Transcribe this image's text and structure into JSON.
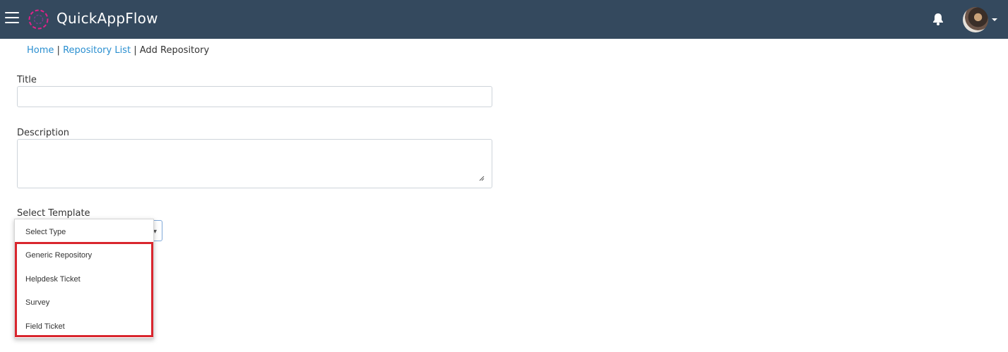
{
  "header": {
    "app_title": "QuickAppFlow",
    "menu_icon": "hamburger-menu-icon",
    "logo_icon": "app-logo-icon",
    "notification_icon": "bell-icon",
    "avatar": "user-avatar",
    "colors": {
      "bar_bg": "#34495e",
      "logo_accent": "#e0218a"
    }
  },
  "breadcrumb": {
    "home": "Home",
    "separator1": "|",
    "repository_list": "Repository List",
    "separator2": "|",
    "current": "Add Repository",
    "link_color": "#2a8fd0"
  },
  "form": {
    "title_label": "Title",
    "title_value": "",
    "description_label": "Description",
    "description_value": "",
    "template_label": "Select Template",
    "template_selected": "Select Type",
    "template_options": [
      "Generic Repository",
      "Helpdesk Ticket",
      "Survey",
      "Field Ticket"
    ],
    "highlight_color": "#d9262e"
  }
}
